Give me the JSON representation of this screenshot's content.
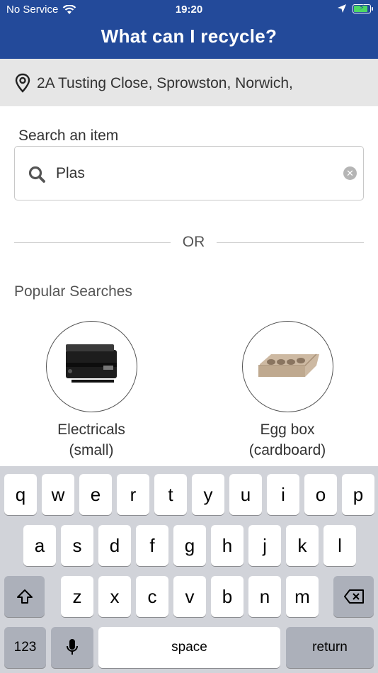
{
  "status_bar": {
    "carrier": "No Service",
    "time": "19:20",
    "battery_level": 0.8
  },
  "header": {
    "title": "What can I recycle?"
  },
  "address": {
    "text": "2A Tusting Close, Sprowston, Norwich,"
  },
  "search": {
    "label": "Search an item",
    "value": "Plas"
  },
  "divider": {
    "or_text": "OR"
  },
  "popular": {
    "heading": "Popular Searches",
    "items": [
      {
        "line1": "Electricals",
        "line2": "(small)"
      },
      {
        "line1": "Egg box",
        "line2": "(cardboard)"
      }
    ]
  },
  "keyboard": {
    "row1": [
      "q",
      "w",
      "e",
      "r",
      "t",
      "y",
      "u",
      "i",
      "o",
      "p"
    ],
    "row2": [
      "a",
      "s",
      "d",
      "f",
      "g",
      "h",
      "j",
      "k",
      "l"
    ],
    "row3": [
      "z",
      "x",
      "c",
      "v",
      "b",
      "n",
      "m"
    ],
    "numbers_key": "123",
    "space_key": "space",
    "return_key": "return"
  },
  "colors": {
    "header_bg": "#234a9a",
    "address_bg": "#e6e6e6",
    "keyboard_bg": "#d1d3d9"
  },
  "icons": [
    "wifi-icon",
    "location-arrow-icon",
    "battery-icon",
    "map-pin-icon",
    "search-icon",
    "clear-icon",
    "shift-icon",
    "backspace-icon",
    "microphone-icon"
  ]
}
